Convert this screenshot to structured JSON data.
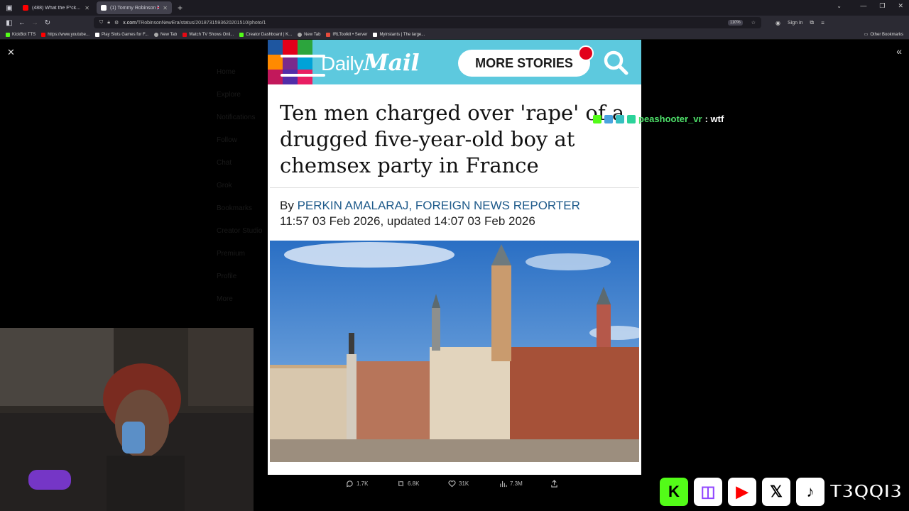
{
  "browser": {
    "tabs": [
      {
        "label": "(488) What the F*ck... - YouTube",
        "active": false,
        "favicon_color": "#ff0000"
      },
      {
        "label": "(1) Tommy Robinson 🇬🇧 (@TRo",
        "active": true,
        "favicon_color": "#ffffff"
      }
    ],
    "new_tab": "+",
    "url_host": "x.com",
    "url_path": "/TRobinsonNewEra/status/2018731593620201510/photo/1",
    "zoom": "110%",
    "sign_in": "Sign in",
    "bookmarks": [
      {
        "label": "KickBot TTS",
        "color": "#53fc18"
      },
      {
        "label": "https://www.youtube...",
        "color": "#ff0000"
      },
      {
        "label": "Play Slots Games for F...",
        "color": "#ffffff"
      },
      {
        "label": "New Tab",
        "color": "#aaaaaa"
      },
      {
        "label": "Watch TV Shows Onli...",
        "color": "#e50914"
      },
      {
        "label": "Creator Dashboard | K...",
        "color": "#53fc18"
      },
      {
        "label": "New Tab",
        "color": "#aaaaaa"
      },
      {
        "label": "IRLToolkit • Server",
        "color": "#e64c3c"
      },
      {
        "label": "Myinstants | The large...",
        "color": "#ffffff"
      }
    ],
    "other_bookmarks": "Other Bookmarks"
  },
  "article": {
    "brand_daily": "Daily",
    "brand_mail": "Mail",
    "more_stories": "MORE STORIES",
    "headline": "Ten men charged over 'rape' of a drugged five-year-old boy at chemsex party in France",
    "by": "By",
    "author": "PERKIN AMALARAJ, FOREIGN NEWS REPORTER",
    "timestamp": "11:57 03 Feb 2026, updated 14:07 03 Feb 2026",
    "header_color": "#5dc9de"
  },
  "post_actions": {
    "replies": "1.7K",
    "reposts": "6.8K",
    "likes": "31K",
    "views": "7.3M"
  },
  "chat": {
    "user": "peashooter_vr",
    "message": " : wtf"
  },
  "stream": {
    "handle": "T3QQI3",
    "platforms": [
      "kick-icon",
      "twitch-icon",
      "youtube-icon",
      "x-icon",
      "tiktok-icon"
    ]
  },
  "x_sidebar_ghost": [
    "Home",
    "Explore",
    "Notifications",
    "Follow",
    "Chat",
    "Grok",
    "Bookmarks",
    "Creator Studio",
    "Premium",
    "Profile",
    "More"
  ]
}
